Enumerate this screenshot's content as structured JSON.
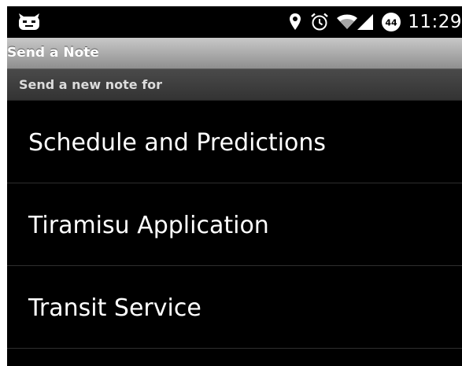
{
  "status_bar": {
    "time": "11:29",
    "battery_level": "44",
    "icons": [
      "cyanogen-mascot-icon",
      "location-pin-icon",
      "alarm-icon",
      "wifi-icon",
      "cell-signal-icon",
      "battery-icon"
    ]
  },
  "title_bar": {
    "title": "Send a Note"
  },
  "section": {
    "header": "Send a new note for"
  },
  "list": {
    "items": [
      {
        "label": "Schedule and Predictions"
      },
      {
        "label": "Tiramisu Application"
      },
      {
        "label": "Transit Service"
      }
    ]
  },
  "colors": {
    "background": "#000000",
    "title_bar_gradient_top": "#c8c8c8",
    "title_bar_gradient_bottom": "#8f8f8f",
    "section_header": "#3d3d3d",
    "divider": "#2e2e2e",
    "text": "#ffffff"
  }
}
